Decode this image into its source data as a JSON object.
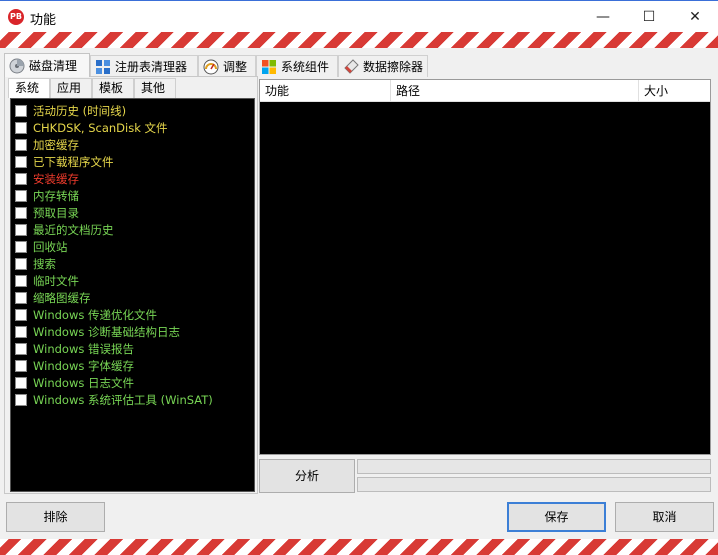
{
  "window": {
    "title": "功能",
    "app_icon_text": "PB",
    "minimize_glyph": "—",
    "maximize_glyph": "☐",
    "close_glyph": "✕"
  },
  "main_tabs": [
    {
      "label": "磁盘清理",
      "icon": "disk-cleanup-icon"
    },
    {
      "label": "注册表清理器",
      "icon": "registry-icon"
    },
    {
      "label": "调整",
      "icon": "gauge-icon"
    },
    {
      "label": "系统组件",
      "icon": "windows-icon"
    },
    {
      "label": "数据擦除器",
      "icon": "eraser-icon"
    }
  ],
  "sub_tabs": [
    "系统",
    "应用",
    "模板",
    "其他"
  ],
  "items": [
    {
      "label": "活动历史 (时间线)",
      "color": "#e6d74b"
    },
    {
      "label": "CHKDSK, ScanDisk 文件",
      "color": "#e6d74b"
    },
    {
      "label": "加密缓存",
      "color": "#e6d74b"
    },
    {
      "label": "已下载程序文件",
      "color": "#e6d74b"
    },
    {
      "label": "安装缓存",
      "color": "#ef3b2c"
    },
    {
      "label": "内存转储",
      "color": "#78d655"
    },
    {
      "label": "预取目录",
      "color": "#78d655"
    },
    {
      "label": "最近的文档历史",
      "color": "#78d655"
    },
    {
      "label": "回收站",
      "color": "#78d655"
    },
    {
      "label": "搜索",
      "color": "#78d655"
    },
    {
      "label": "临时文件",
      "color": "#78d655"
    },
    {
      "label": "缩略图缓存",
      "color": "#78d655"
    },
    {
      "label": "Windows 传递优化文件",
      "color": "#78d655"
    },
    {
      "label": "Windows 诊断基础结构日志",
      "color": "#78d655"
    },
    {
      "label": "Windows 错误报告",
      "color": "#78d655"
    },
    {
      "label": "Windows 字体缓存",
      "color": "#78d655"
    },
    {
      "label": "Windows 日志文件",
      "color": "#78d655"
    },
    {
      "label": "Windows 系统评估工具 (WinSAT)",
      "color": "#78d655"
    }
  ],
  "results_table": {
    "columns": [
      "功能",
      "路径",
      "大小"
    ]
  },
  "buttons": {
    "analyze": "分析",
    "exclude": "排除",
    "save": "保存",
    "cancel": "取消"
  },
  "colors": {
    "stripe_red": "#d83a35",
    "accent_blue": "#3c7fd6"
  }
}
